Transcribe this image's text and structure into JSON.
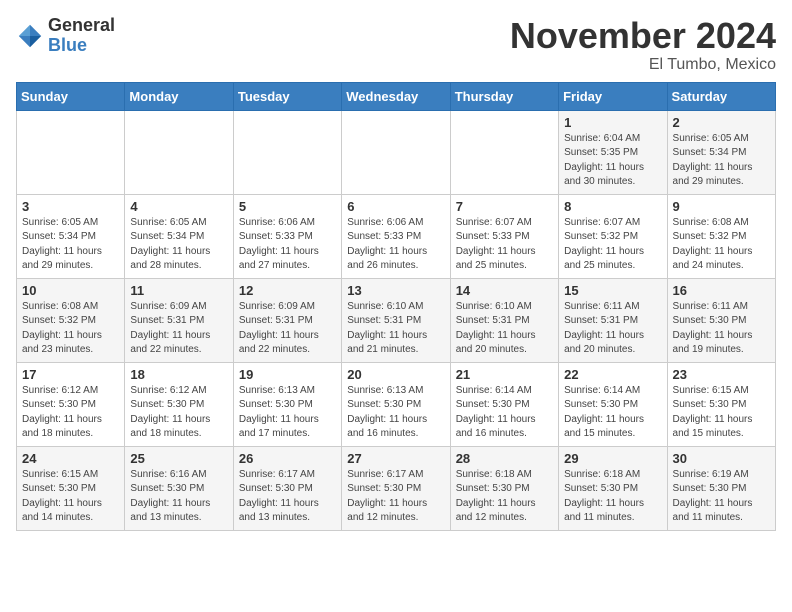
{
  "header": {
    "logo_general": "General",
    "logo_blue": "Blue",
    "month_title": "November 2024",
    "location": "El Tumbo, Mexico"
  },
  "weekdays": [
    "Sunday",
    "Monday",
    "Tuesday",
    "Wednesday",
    "Thursday",
    "Friday",
    "Saturday"
  ],
  "weeks": [
    [
      {
        "day": "",
        "info": ""
      },
      {
        "day": "",
        "info": ""
      },
      {
        "day": "",
        "info": ""
      },
      {
        "day": "",
        "info": ""
      },
      {
        "day": "",
        "info": ""
      },
      {
        "day": "1",
        "info": "Sunrise: 6:04 AM\nSunset: 5:35 PM\nDaylight: 11 hours and 30 minutes."
      },
      {
        "day": "2",
        "info": "Sunrise: 6:05 AM\nSunset: 5:34 PM\nDaylight: 11 hours and 29 minutes."
      }
    ],
    [
      {
        "day": "3",
        "info": "Sunrise: 6:05 AM\nSunset: 5:34 PM\nDaylight: 11 hours and 29 minutes."
      },
      {
        "day": "4",
        "info": "Sunrise: 6:05 AM\nSunset: 5:34 PM\nDaylight: 11 hours and 28 minutes."
      },
      {
        "day": "5",
        "info": "Sunrise: 6:06 AM\nSunset: 5:33 PM\nDaylight: 11 hours and 27 minutes."
      },
      {
        "day": "6",
        "info": "Sunrise: 6:06 AM\nSunset: 5:33 PM\nDaylight: 11 hours and 26 minutes."
      },
      {
        "day": "7",
        "info": "Sunrise: 6:07 AM\nSunset: 5:33 PM\nDaylight: 11 hours and 25 minutes."
      },
      {
        "day": "8",
        "info": "Sunrise: 6:07 AM\nSunset: 5:32 PM\nDaylight: 11 hours and 25 minutes."
      },
      {
        "day": "9",
        "info": "Sunrise: 6:08 AM\nSunset: 5:32 PM\nDaylight: 11 hours and 24 minutes."
      }
    ],
    [
      {
        "day": "10",
        "info": "Sunrise: 6:08 AM\nSunset: 5:32 PM\nDaylight: 11 hours and 23 minutes."
      },
      {
        "day": "11",
        "info": "Sunrise: 6:09 AM\nSunset: 5:31 PM\nDaylight: 11 hours and 22 minutes."
      },
      {
        "day": "12",
        "info": "Sunrise: 6:09 AM\nSunset: 5:31 PM\nDaylight: 11 hours and 22 minutes."
      },
      {
        "day": "13",
        "info": "Sunrise: 6:10 AM\nSunset: 5:31 PM\nDaylight: 11 hours and 21 minutes."
      },
      {
        "day": "14",
        "info": "Sunrise: 6:10 AM\nSunset: 5:31 PM\nDaylight: 11 hours and 20 minutes."
      },
      {
        "day": "15",
        "info": "Sunrise: 6:11 AM\nSunset: 5:31 PM\nDaylight: 11 hours and 20 minutes."
      },
      {
        "day": "16",
        "info": "Sunrise: 6:11 AM\nSunset: 5:30 PM\nDaylight: 11 hours and 19 minutes."
      }
    ],
    [
      {
        "day": "17",
        "info": "Sunrise: 6:12 AM\nSunset: 5:30 PM\nDaylight: 11 hours and 18 minutes."
      },
      {
        "day": "18",
        "info": "Sunrise: 6:12 AM\nSunset: 5:30 PM\nDaylight: 11 hours and 18 minutes."
      },
      {
        "day": "19",
        "info": "Sunrise: 6:13 AM\nSunset: 5:30 PM\nDaylight: 11 hours and 17 minutes."
      },
      {
        "day": "20",
        "info": "Sunrise: 6:13 AM\nSunset: 5:30 PM\nDaylight: 11 hours and 16 minutes."
      },
      {
        "day": "21",
        "info": "Sunrise: 6:14 AM\nSunset: 5:30 PM\nDaylight: 11 hours and 16 minutes."
      },
      {
        "day": "22",
        "info": "Sunrise: 6:14 AM\nSunset: 5:30 PM\nDaylight: 11 hours and 15 minutes."
      },
      {
        "day": "23",
        "info": "Sunrise: 6:15 AM\nSunset: 5:30 PM\nDaylight: 11 hours and 15 minutes."
      }
    ],
    [
      {
        "day": "24",
        "info": "Sunrise: 6:15 AM\nSunset: 5:30 PM\nDaylight: 11 hours and 14 minutes."
      },
      {
        "day": "25",
        "info": "Sunrise: 6:16 AM\nSunset: 5:30 PM\nDaylight: 11 hours and 13 minutes."
      },
      {
        "day": "26",
        "info": "Sunrise: 6:17 AM\nSunset: 5:30 PM\nDaylight: 11 hours and 13 minutes."
      },
      {
        "day": "27",
        "info": "Sunrise: 6:17 AM\nSunset: 5:30 PM\nDaylight: 11 hours and 12 minutes."
      },
      {
        "day": "28",
        "info": "Sunrise: 6:18 AM\nSunset: 5:30 PM\nDaylight: 11 hours and 12 minutes."
      },
      {
        "day": "29",
        "info": "Sunrise: 6:18 AM\nSunset: 5:30 PM\nDaylight: 11 hours and 11 minutes."
      },
      {
        "day": "30",
        "info": "Sunrise: 6:19 AM\nSunset: 5:30 PM\nDaylight: 11 hours and 11 minutes."
      }
    ]
  ]
}
